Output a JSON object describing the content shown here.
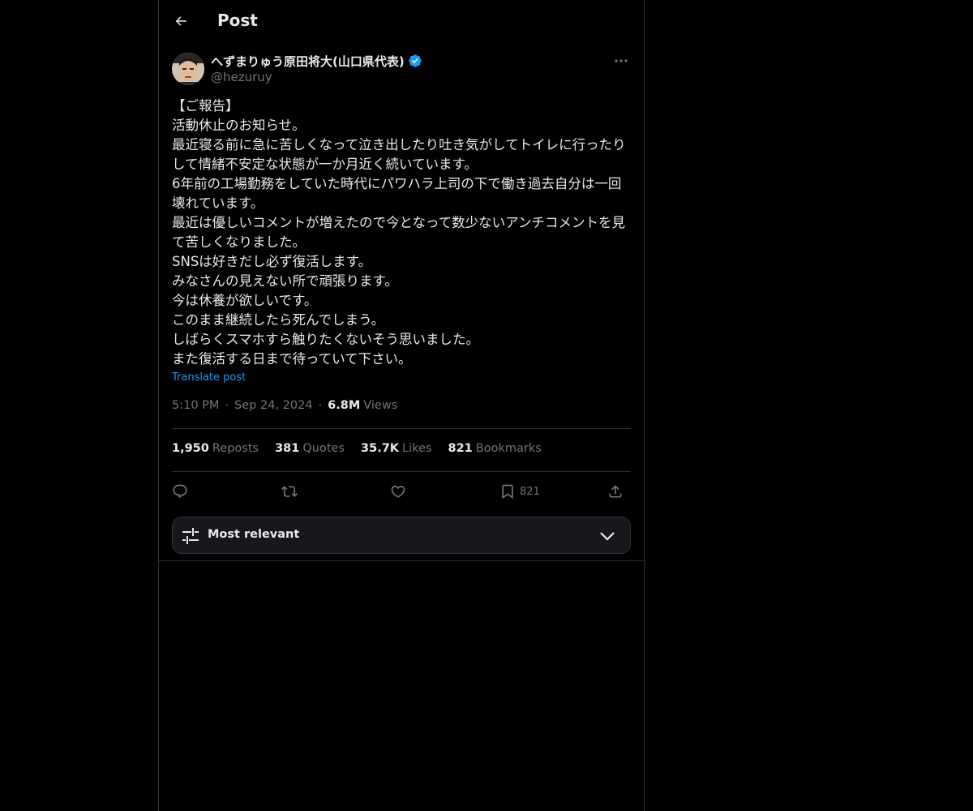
{
  "header": {
    "title": "Post"
  },
  "author": {
    "display_name": "へずまりゅう原田将大(山口県代表)",
    "handle": "@hezuruy",
    "verified": true
  },
  "post": {
    "text": "【ご報告】\n活動休止のお知らせ。\n最近寝る前に急に苦しくなって泣き出したり吐き気がしてトイレに行ったりして情緒不安定な状態が一か月近く続いています。\n6年前の工場勤務をしていた時代にパワハラ上司の下で働き過去自分は一回壊れています。\n最近は優しいコメントが増えたので今となって数少ないアンチコメントを見て苦しくなりました。\nSNSは好きだし必ず復活します。\nみなさんの見えない所で頑張ります。\n今は休養が欲しいです。\nこのまま継続したら死んでしまう。\nしばらくスマホすら触りたくないそう思いました。\nまた復活する日まで待っていて下さい。",
    "translate_label": "Translate post"
  },
  "meta": {
    "time": "5:10 PM",
    "date": "Sep 24, 2024",
    "views_count": "6.8M",
    "views_label": "Views"
  },
  "stats": {
    "reposts_count": "1,950",
    "reposts_label": "Reposts",
    "quotes_count": "381",
    "quotes_label": "Quotes",
    "likes_count": "35.7K",
    "likes_label": "Likes",
    "bookmarks_count": "821",
    "bookmarks_label": "Bookmarks"
  },
  "actions": {
    "bookmark_count": "821",
    "icons": [
      "reply-icon",
      "repost-icon",
      "like-icon",
      "bookmark-icon",
      "share-icon"
    ]
  },
  "sort": {
    "label": "Most relevant"
  },
  "colors": {
    "background": "#000000",
    "text_primary": "#e7e9ea",
    "text_secondary": "#71767b",
    "accent": "#1d9bf0",
    "border": "#2f3336"
  }
}
